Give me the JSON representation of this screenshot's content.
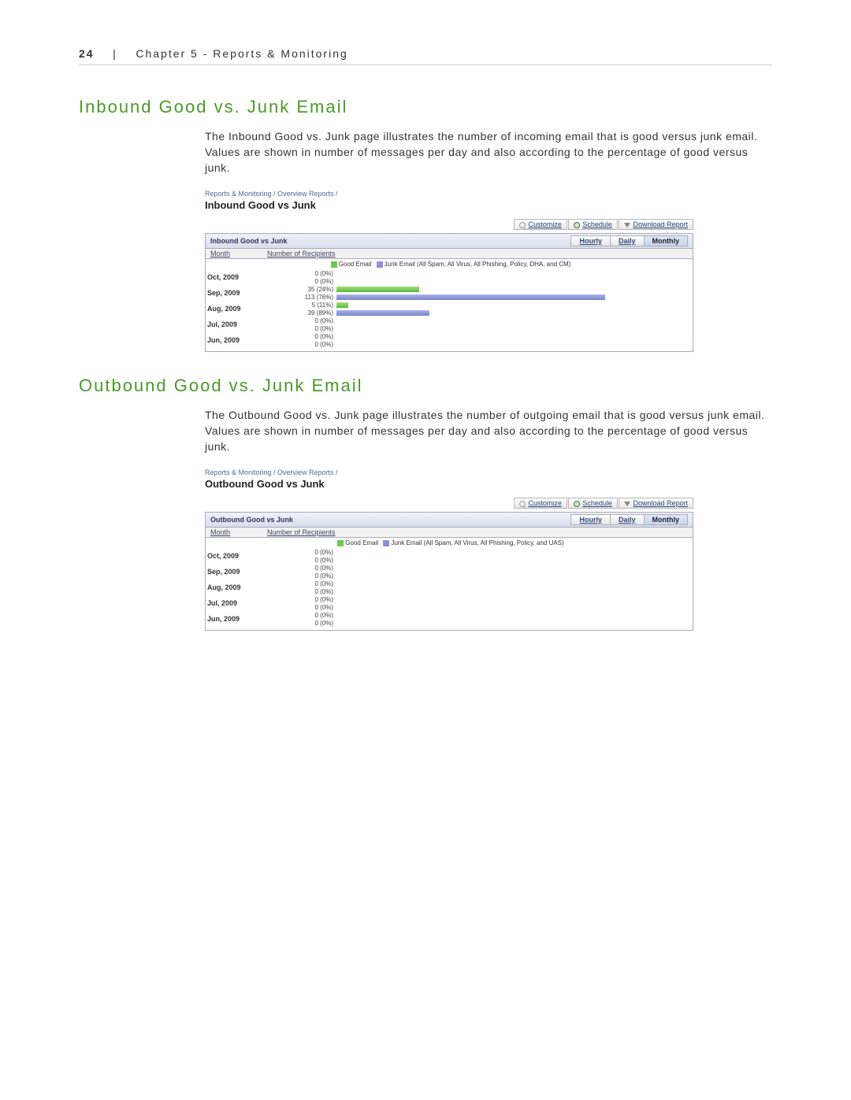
{
  "header": {
    "page_number": "24",
    "sep": "|",
    "chapter": "Chapter 5 - Reports & Monitoring"
  },
  "sections": {
    "inbound": {
      "heading": "Inbound Good vs. Junk Email",
      "para": "The Inbound Good vs. Junk page illustrates the number of incoming email that is good versus junk email. Values are shown in number of messages per day and also according to the percentage of good versus junk."
    },
    "outbound": {
      "heading": "Outbound Good vs. Junk Email",
      "para": "The Outbound Good vs. Junk page illustrates the number of outgoing email that is good versus junk email. Values are shown in number of messages per day and also according to the percentage of good versus junk."
    }
  },
  "report_common": {
    "breadcrumb": "Reports & Monitoring / Overview Reports /",
    "buttons": {
      "customize": "Customize",
      "schedule": "Schedule",
      "download": "Download Report"
    },
    "tabs": {
      "hourly": "Hourly",
      "daily": "Daily",
      "monthly": "Monthly"
    },
    "columns": {
      "month": "Month",
      "num": "Number of Recipients"
    },
    "legend": {
      "good": "Good Email"
    }
  },
  "inbound_report": {
    "title": "Inbound Good vs Junk",
    "panel_title": "Inbound Good vs Junk",
    "legend_junk": "Junk Email (All Spam, All Virus, All Phishing, Policy, DHA, and CM)"
  },
  "outbound_report": {
    "title": "Outbound Good vs Junk",
    "panel_title": "Outbound Good vs Junk",
    "legend_junk": "Junk Email (All Spam, All Virus, All Phishing, Policy, and UAS)"
  },
  "chart_data": [
    {
      "type": "bar",
      "title": "Inbound Good vs Junk",
      "xlabel": "Number of Recipients",
      "ylabel": "Month",
      "categories": [
        "Oct, 2009",
        "Sep, 2009",
        "Aug, 2009",
        "Jul, 2009",
        "Jun, 2009"
      ],
      "series": [
        {
          "name": "Good Email",
          "values": [
            0,
            35,
            5,
            0,
            0
          ],
          "percent": [
            0,
            24,
            11,
            0,
            0
          ],
          "labels": [
            "0 (0%)",
            "35 (24%)",
            "5 (11%)",
            "0 (0%)",
            "0 (0%)"
          ]
        },
        {
          "name": "Junk Email (All Spam, All Virus, All Phishing, Policy, DHA, and CM)",
          "values": [
            0,
            113,
            39,
            0,
            0
          ],
          "percent": [
            0,
            76,
            89,
            0,
            0
          ],
          "labels": [
            "0 (0%)",
            "113 (76%)",
            "39 (89%)",
            "0 (0%)",
            "0 (0%)"
          ]
        }
      ],
      "xlim": [
        0,
        150
      ]
    },
    {
      "type": "bar",
      "title": "Outbound Good vs Junk",
      "xlabel": "Number of Recipients",
      "ylabel": "Month",
      "categories": [
        "Oct, 2009",
        "Sep, 2009",
        "Aug, 2009",
        "Jul, 2009",
        "Jun, 2009"
      ],
      "series": [
        {
          "name": "Good Email",
          "values": [
            0,
            0,
            0,
            0,
            0
          ],
          "percent": [
            0,
            0,
            0,
            0,
            0
          ],
          "labels": [
            "0 (0%)",
            "0 (0%)",
            "0 (0%)",
            "0 (0%)",
            "0 (0%)"
          ]
        },
        {
          "name": "Junk Email (All Spam, All Virus, All Phishing, Policy, and UAS)",
          "values": [
            0,
            0,
            0,
            0,
            0
          ],
          "percent": [
            0,
            0,
            0,
            0,
            0
          ],
          "labels": [
            "0 (0%)",
            "0 (0%)",
            "0 (0%)",
            "0 (0%)",
            "0 (0%)"
          ]
        }
      ],
      "xlim": [
        0,
        150
      ]
    }
  ]
}
